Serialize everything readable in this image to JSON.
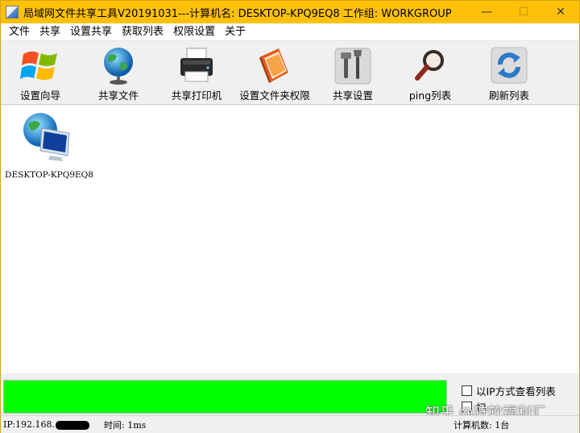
{
  "window": {
    "title": "局域网文件共享工具V20191031---计算机名: DESKTOP-KPQ9EQ8  工作组: WORKGROUP",
    "minimize": "—",
    "maximize": "☐",
    "close": "✕"
  },
  "menu": [
    "文件",
    "共享",
    "设置共享",
    "获取列表",
    "权限设置",
    "关于"
  ],
  "toolbar": [
    {
      "label": "设置向导",
      "icon": "windows-logo-icon"
    },
    {
      "label": "共享文件",
      "icon": "globe-icon"
    },
    {
      "label": "共享打印机",
      "icon": "printer-icon"
    },
    {
      "label": "设置文件夹权限",
      "icon": "folder-book-icon"
    },
    {
      "label": "共享设置",
      "icon": "tools-icon"
    },
    {
      "label": "ping列表",
      "icon": "magnifier-icon"
    },
    {
      "label": "刷新列表",
      "icon": "refresh-icon"
    }
  ],
  "computers": [
    {
      "name": "DESKTOP-KPQ9EQ8",
      "icon": "network-computer-icon"
    }
  ],
  "bottom": {
    "progress_percent": 100,
    "progress_color": "#00ff00",
    "option_ip_view": "以IP方式查看列表",
    "option_two_partial": "扫"
  },
  "watermark": "知乎 @狩软福利汇",
  "status": {
    "ip_label": "IP:192.168.",
    "time_label": "时间: 1ms",
    "count_label": "计算机数: 1台"
  },
  "colors": {
    "titlebar": "#ffc107",
    "progress": "#00ff00"
  }
}
